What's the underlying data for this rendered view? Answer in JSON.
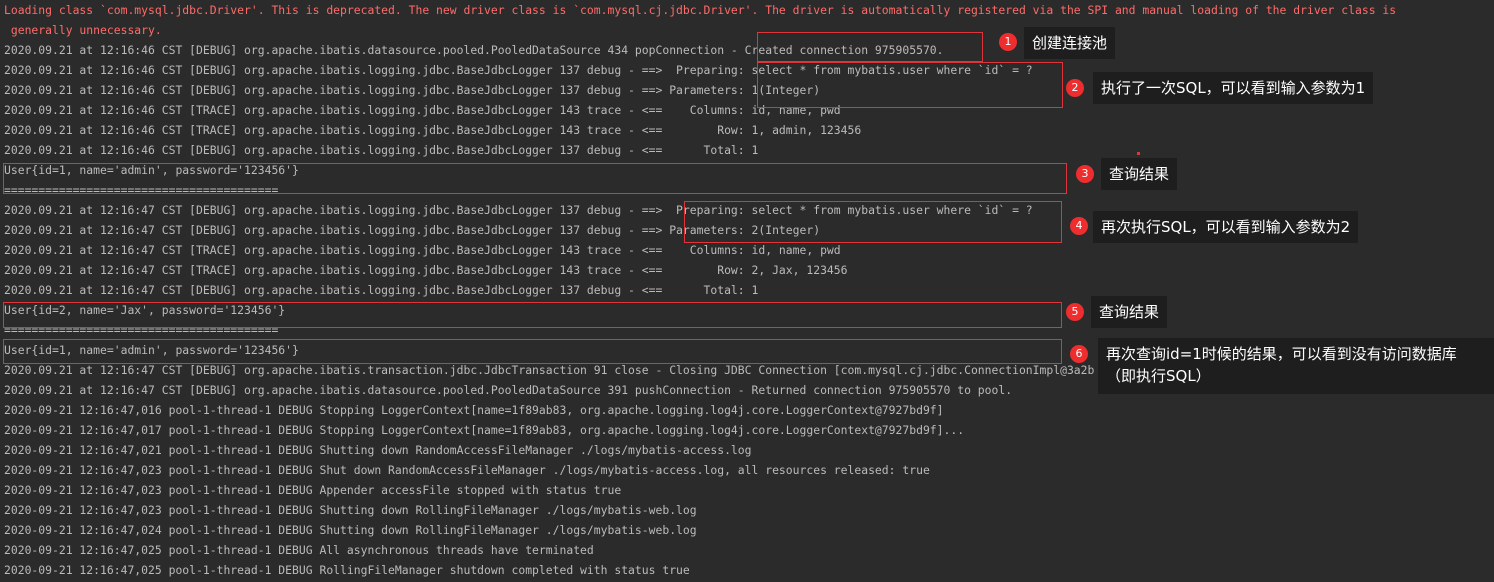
{
  "console": {
    "lines": [
      "Loading class `com.mysql.jdbc.Driver'. This is deprecated. The new driver class is `com.mysql.cj.jdbc.Driver'. The driver is automatically registered via the SPI and manual loading of the driver class is",
      " generally unnecessary.",
      "2020.09.21 at 12:16:46 CST [DEBUG] org.apache.ibatis.datasource.pooled.PooledDataSource 434 popConnection - Created connection 975905570.",
      "2020.09.21 at 12:16:46 CST [DEBUG] org.apache.ibatis.logging.jdbc.BaseJdbcLogger 137 debug - ==>  Preparing: select * from mybatis.user where `id` = ?",
      "2020.09.21 at 12:16:46 CST [DEBUG] org.apache.ibatis.logging.jdbc.BaseJdbcLogger 137 debug - ==> Parameters: 1(Integer)",
      "2020.09.21 at 12:16:46 CST [TRACE] org.apache.ibatis.logging.jdbc.BaseJdbcLogger 143 trace - <==    Columns: id, name, pwd",
      "2020.09.21 at 12:16:46 CST [TRACE] org.apache.ibatis.logging.jdbc.BaseJdbcLogger 143 trace - <==        Row: 1, admin, 123456",
      "2020.09.21 at 12:16:46 CST [DEBUG] org.apache.ibatis.logging.jdbc.BaseJdbcLogger 137 debug - <==      Total: 1",
      "User{id=1, name='admin', password='123456'}",
      "========================================",
      "2020.09.21 at 12:16:47 CST [DEBUG] org.apache.ibatis.logging.jdbc.BaseJdbcLogger 137 debug - ==>  Preparing: select * from mybatis.user where `id` = ?",
      "2020.09.21 at 12:16:47 CST [DEBUG] org.apache.ibatis.logging.jdbc.BaseJdbcLogger 137 debug - ==> Parameters: 2(Integer)",
      "2020.09.21 at 12:16:47 CST [TRACE] org.apache.ibatis.logging.jdbc.BaseJdbcLogger 143 trace - <==    Columns: id, name, pwd",
      "2020.09.21 at 12:16:47 CST [TRACE] org.apache.ibatis.logging.jdbc.BaseJdbcLogger 143 trace - <==        Row: 2, Jax, 123456",
      "2020.09.21 at 12:16:47 CST [DEBUG] org.apache.ibatis.logging.jdbc.BaseJdbcLogger 137 debug - <==      Total: 1",
      "User{id=2, name='Jax', password='123456'}",
      "========================================",
      "User{id=1, name='admin', password='123456'}",
      "2020.09.21 at 12:16:47 CST [DEBUG] org.apache.ibatis.transaction.jdbc.JdbcTransaction 91 close - Closing JDBC Connection [com.mysql.cj.jdbc.ConnectionImpl@3a2b",
      "2020.09.21 at 12:16:47 CST [DEBUG] org.apache.ibatis.datasource.pooled.PooledDataSource 391 pushConnection - Returned connection 975905570 to pool.",
      "2020-09-21 12:16:47,016 pool-1-thread-1 DEBUG Stopping LoggerContext[name=1f89ab83, org.apache.logging.log4j.core.LoggerContext@7927bd9f]",
      "2020-09-21 12:16:47,017 pool-1-thread-1 DEBUG Stopping LoggerContext[name=1f89ab83, org.apache.logging.log4j.core.LoggerContext@7927bd9f]...",
      "2020-09-21 12:16:47,021 pool-1-thread-1 DEBUG Shutting down RandomAccessFileManager ./logs/mybatis-access.log",
      "2020-09-21 12:16:47,023 pool-1-thread-1 DEBUG Shut down RandomAccessFileManager ./logs/mybatis-access.log, all resources released: true",
      "2020-09-21 12:16:47,023 pool-1-thread-1 DEBUG Appender accessFile stopped with status true",
      "2020-09-21 12:16:47,023 pool-1-thread-1 DEBUG Shutting down RollingFileManager ./logs/mybatis-web.log",
      "2020-09-21 12:16:47,024 pool-1-thread-1 DEBUG Shutting down RollingFileManager ./logs/mybatis-web.log",
      "2020-09-21 12:16:47,025 pool-1-thread-1 DEBUG All asynchronous threads have terminated",
      "2020-09-21 12:16:47,025 pool-1-thread-1 DEBUG RollingFileManager shutdown completed with status true"
    ]
  },
  "annotations": [
    {
      "number": "1",
      "text": "创建连接池"
    },
    {
      "number": "2",
      "text": "执行了一次SQL，可以看到输入参数为1"
    },
    {
      "number": "3",
      "text": "查询结果"
    },
    {
      "number": "4",
      "text": "再次执行SQL，可以看到输入参数为2"
    },
    {
      "number": "5",
      "text": "查询结果"
    },
    {
      "number": "6",
      "text_line1": "再次查询id=1时候的结果，可以看到没有访问数据库",
      "text_line2": "（即执行SQL）"
    }
  ],
  "colors": {
    "background": "#2b2b2b",
    "log_text": "#bbbbbb",
    "warning_text": "#ff6b68",
    "highlight": "#e0343b",
    "note_background": "#1e1e1e"
  }
}
